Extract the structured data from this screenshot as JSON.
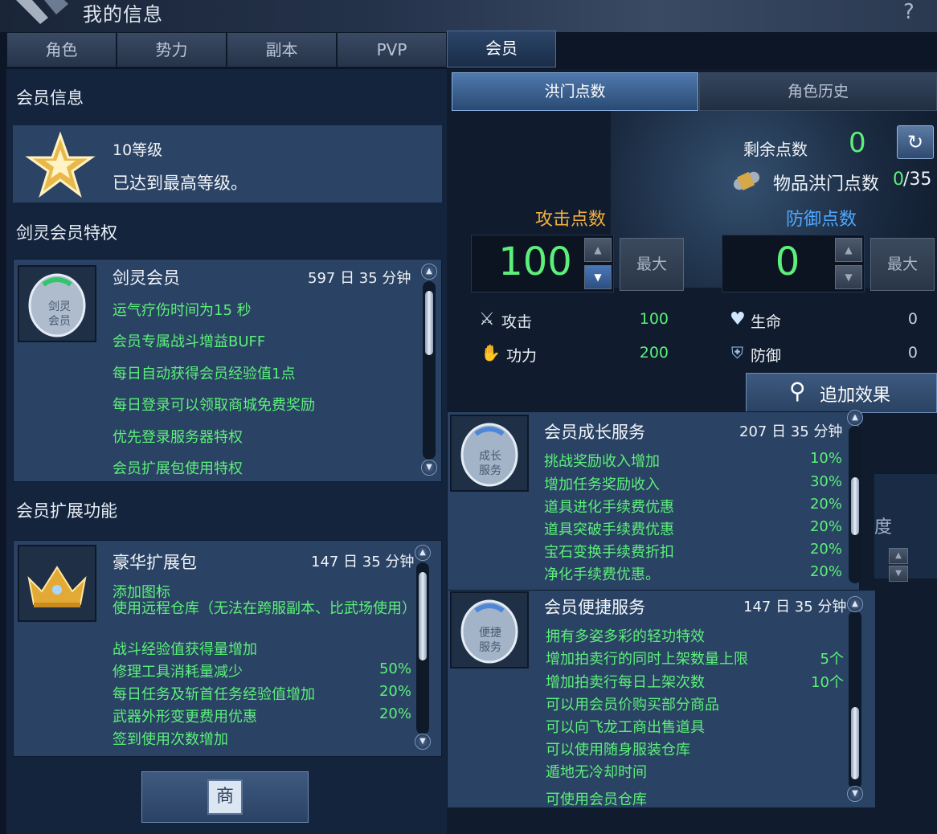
{
  "window": {
    "title": "我的信息",
    "help_icon": "?"
  },
  "tabs": [
    {
      "label": "角色"
    },
    {
      "label": "势力"
    },
    {
      "label": "副本"
    },
    {
      "label": "PVP"
    },
    {
      "label": "会员"
    }
  ],
  "active_tab": "会员",
  "left": {
    "member_info_title": "会员信息",
    "level": {
      "label": "10等级",
      "desc": "已达到最高等级。"
    },
    "privilege_title": "剑灵会员特权",
    "privilege": {
      "name": "剑灵会员",
      "time": "597 日 35 分钟",
      "lines": [
        "运气疗伤时间为15 秒",
        "会员专属战斗增益BUFF",
        "每日自动获得会员经验值1点",
        "每日登录可以领取商城免费奖励",
        "优先登录服务器特权",
        "会员扩展包使用特权"
      ]
    },
    "extension_title": "会员扩展功能",
    "extension": {
      "name": "豪华扩展包",
      "time": "147 日 35 分钟",
      "lines": [
        {
          "text": "添加图标",
          "pct": ""
        },
        {
          "text": "使用远程仓库（无法在跨服副本、比武场使用）",
          "pct": ""
        },
        {
          "text": "战斗经验值获得量增加",
          "pct": ""
        },
        {
          "text": "修理工具消耗量减少",
          "pct": "50%"
        },
        {
          "text": "每日任务及斩首任务经验值增加",
          "pct": "20%"
        },
        {
          "text": "武器外形变更费用优惠",
          "pct": "20%"
        },
        {
          "text": "签到使用次数增加",
          "pct": ""
        }
      ]
    },
    "shop_button": "商"
  },
  "right": {
    "subtabs": [
      {
        "label": "洪门点数"
      },
      {
        "label": "角色历史"
      }
    ],
    "remaining_label": "剩余点数",
    "remaining_value": "0",
    "item_points_label": "物品洪门点数",
    "item_points_value": "0",
    "item_points_max": "/35",
    "attack_title": "攻击点数",
    "attack_value": "100",
    "max_label": "最大",
    "defense_title": "防御点数",
    "defense_value": "0",
    "stats": {
      "attack_label": "攻击",
      "attack_val": "100",
      "power_label": "功力",
      "power_val": "200",
      "life_label": "生命",
      "life_val": "0",
      "defense_label": "防御",
      "defense_val": "0"
    },
    "add_effect": "追加效果",
    "growth": {
      "name": "会员成长服务",
      "time": "207 日 35 分钟",
      "lines": [
        {
          "text": "挑战奖励收入增加",
          "pct": "10%"
        },
        {
          "text": "增加任务奖励收入",
          "pct": "30%"
        },
        {
          "text": "道具进化手续费优惠",
          "pct": "20%"
        },
        {
          "text": "道具突破手续费优惠",
          "pct": "20%"
        },
        {
          "text": "宝石变换手续费折扣",
          "pct": "20%"
        },
        {
          "text": "净化手续费优惠。",
          "pct": "20%"
        }
      ]
    },
    "convenience": {
      "name": "会员便捷服务",
      "time": "147 日 35 分钟",
      "lines": [
        {
          "text": "拥有多姿多彩的轻功特效",
          "pct": ""
        },
        {
          "text": "增加拍卖行的同时上架数量上限",
          "pct": "5个"
        },
        {
          "text": "增加拍卖行每日上架次数",
          "pct": "10个"
        },
        {
          "text": "可以用会员价购买部分商品",
          "pct": ""
        },
        {
          "text": "可以向飞龙工商出售道具",
          "pct": ""
        },
        {
          "text": "可以使用随身服装仓库",
          "pct": ""
        },
        {
          "text": "遁地无冷却时间",
          "pct": ""
        },
        {
          "text": "可使用会员仓库",
          "pct": ""
        }
      ]
    },
    "partial_text": "度"
  },
  "colors": {
    "accent_green": "#5cf07a",
    "attack_title": "#f0b040",
    "defense_title": "#4fa8ff"
  }
}
